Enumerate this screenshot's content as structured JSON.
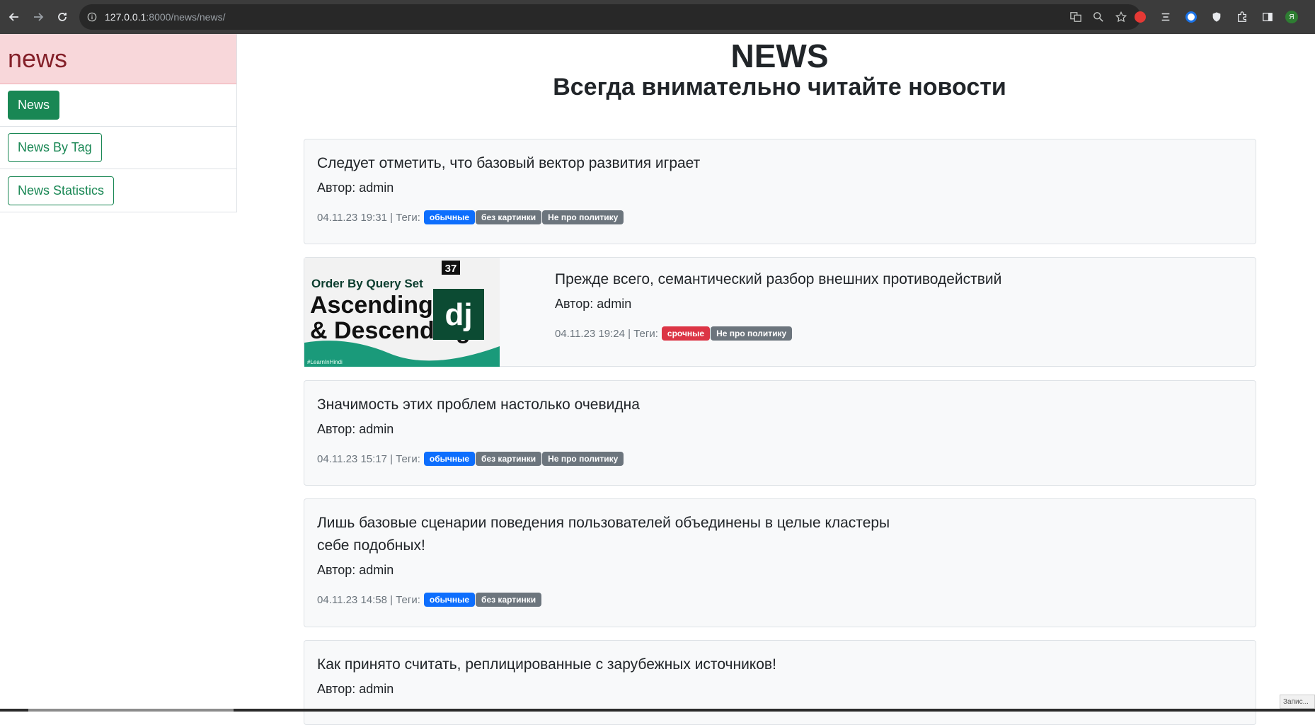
{
  "browser": {
    "url_host": "127.0.0.1",
    "url_path": ":8000/news/news/",
    "ext_letter": "Я"
  },
  "sidebar": {
    "title": "news",
    "items": [
      {
        "label": "News",
        "active": true
      },
      {
        "label": "News By Tag",
        "active": false
      },
      {
        "label": "News Statistics",
        "active": false
      }
    ]
  },
  "header": {
    "title": "NEWS",
    "subtitle": "Всегда внимательно читайте новости"
  },
  "news": [
    {
      "title": "Следует отметить, что базовый вектор развития играет",
      "author": "Автор: admin",
      "meta": "04.11.23 19:31 | Теги:",
      "tags": [
        "обычные",
        "без картинки",
        "Не про политику"
      ]
    },
    {
      "title": "Прежде всего, семантический разбор внешних противодействий",
      "author": "Автор: admin",
      "meta": "04.11.23 19:24 | Теги:",
      "tags": [
        "срочные",
        "Не про политику"
      ],
      "image": {
        "badge": "37",
        "line1": "Order By Query Set",
        "line2": "Ascending",
        "line3": "& Descending",
        "logo": "dj",
        "footer": "#LearnInHindi"
      }
    },
    {
      "title": "Значимость этих проблем настолько очевидна",
      "author": "Автор: admin",
      "meta": "04.11.23 15:17 | Теги:",
      "tags": [
        "обычные",
        "без картинки",
        "Не про политику"
      ]
    },
    {
      "title_line1": "Лишь базовые сценарии поведения пользователей объединены в целые кластеры",
      "title_line2": "себе подобных!",
      "author": "Автор: admin",
      "meta": "04.11.23 14:58 | Теги:",
      "tags": [
        "обычные",
        "без картинки"
      ]
    },
    {
      "title": "Как принято считать, реплицированные с зарубежных источников!",
      "author": "Автор: admin"
    }
  ],
  "colors": {
    "primary_tag": "#0d6efd",
    "secondary_tag": "#6c757d",
    "danger_tag": "#dc3545",
    "success_button": "#198754",
    "sidebar_header_bg": "#f8d7da"
  },
  "corner_note": "Запис..."
}
